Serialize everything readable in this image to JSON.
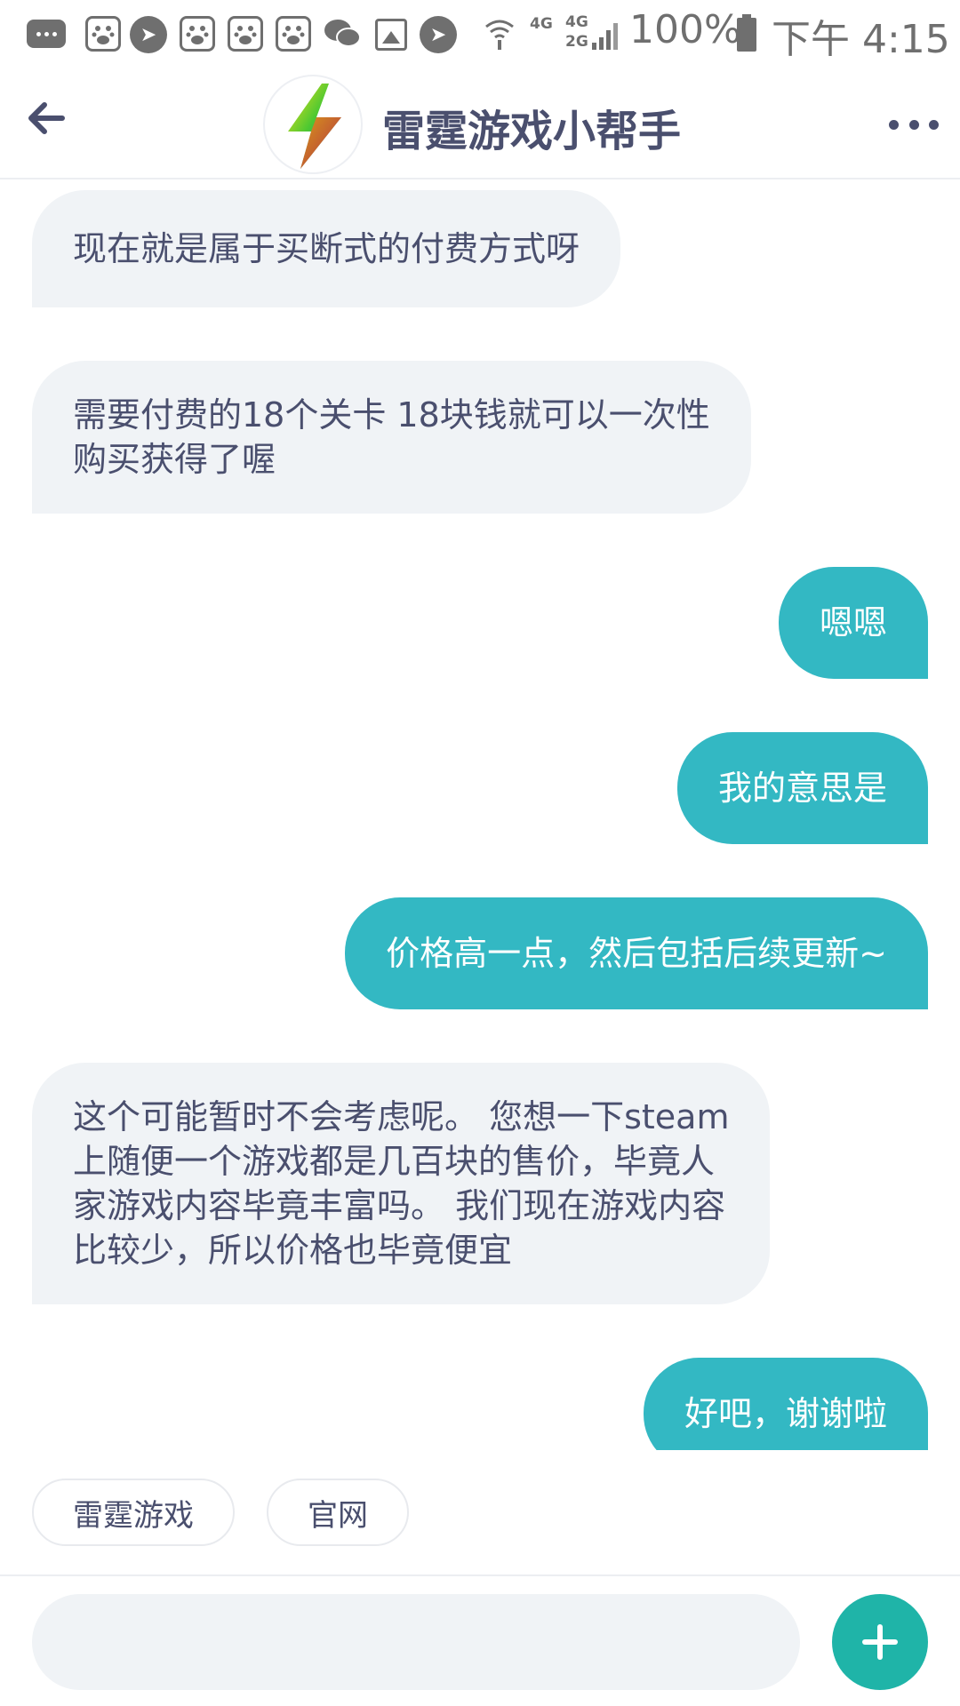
{
  "status_bar": {
    "battery": "100%",
    "time": "下午 4:15",
    "network_1": "4G",
    "network_2_top": "4G",
    "network_2_bottom": "2G"
  },
  "header": {
    "title": "雷霆游戏小帮手"
  },
  "messages": [
    {
      "from": "bot",
      "text": "现在就是属于买断式的付费方式呀"
    },
    {
      "from": "bot",
      "text": "需要付费的18个关卡 18块钱就可以一次性\n购买获得了喔"
    },
    {
      "from": "user",
      "text": "嗯嗯"
    },
    {
      "from": "user",
      "text": "我的意思是"
    },
    {
      "from": "user",
      "text": "价格高一点，然后包括后续更新~"
    },
    {
      "from": "bot",
      "text": "这个可能暂时不会考虑呢。 您想一下steam\n上随便一个游戏都是几百块的售价，毕竟人\n家游戏内容毕竟丰富吗。 我们现在游戏内容\n比较少，所以价格也毕竟便宜"
    },
    {
      "from": "user",
      "text": "好吧，谢谢啦"
    }
  ],
  "quick_replies": [
    "雷霆游戏",
    "官网"
  ],
  "input": {
    "value": "",
    "placeholder": ""
  },
  "colors": {
    "accent": "#33b8c3",
    "plus_button": "#1fb4a8",
    "bot_bubble": "#f0f3f6",
    "text": "#4a4f6e"
  }
}
